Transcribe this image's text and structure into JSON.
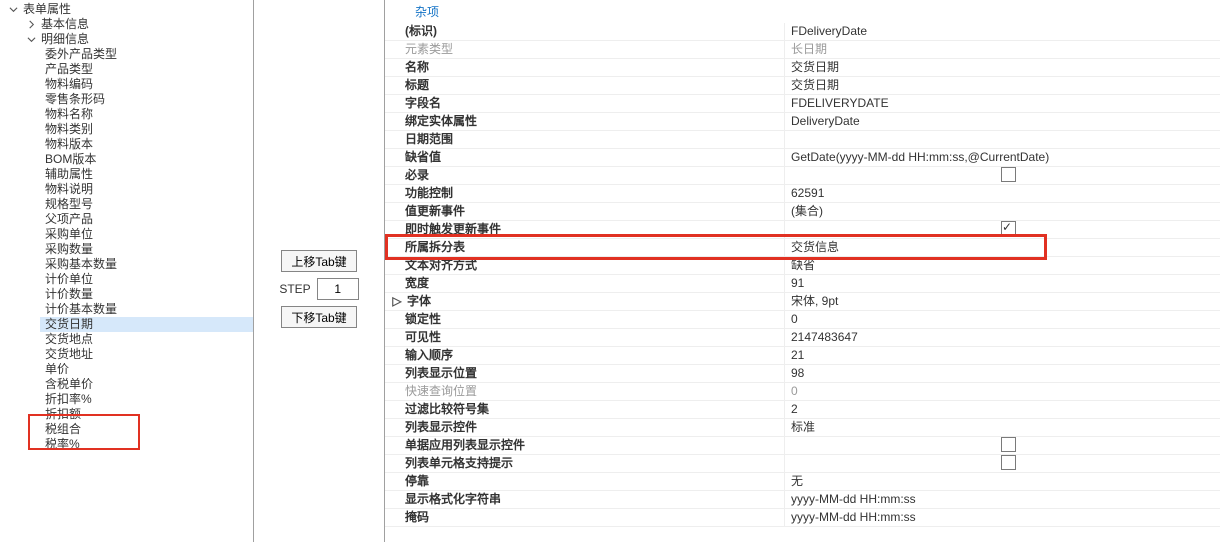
{
  "tree": {
    "root": {
      "label": "表单属性",
      "expanded": true
    },
    "basic": {
      "label": "基本信息",
      "expanded": false
    },
    "detail": {
      "label": "明细信息",
      "expanded": true
    },
    "items": [
      "委外产品类型",
      "产品类型",
      "物料编码",
      "零售条形码",
      "物料名称",
      "物料类别",
      "物料版本",
      "BOM版本",
      "辅助属性",
      "物料说明",
      "规格型号",
      "父项产品",
      "采购单位",
      "采购数量",
      "采购基本数量",
      "计价单位",
      "计价数量",
      "计价基本数量",
      "交货日期",
      "交货地点",
      "交货地址",
      "单价",
      "含税单价",
      "折扣率%",
      "折扣额",
      "税组合",
      "税率%"
    ],
    "selectedIndex": 18
  },
  "mid": {
    "btnUp": "上移Tab键",
    "stepLabel": "STEP",
    "stepValue": "1",
    "btnDown": "下移Tab键"
  },
  "cat": "杂项",
  "rows": [
    {
      "k": "(标识)",
      "v": "FDeliveryDate",
      "bold": true,
      "ind": 14
    },
    {
      "k": "元素类型",
      "v": "长日期",
      "dim": true,
      "ind": 14
    },
    {
      "k": "名称",
      "v": "交货日期",
      "bold": true,
      "ind": 14
    },
    {
      "k": "标题",
      "v": "交货日期",
      "bold": true,
      "ind": 14
    },
    {
      "k": "字段名",
      "v": "FDELIVERYDATE",
      "bold": true,
      "ind": 14
    },
    {
      "k": "绑定实体属性",
      "v": "DeliveryDate",
      "bold": true,
      "ind": 14
    },
    {
      "k": "日期范围",
      "v": "",
      "bold": true,
      "ind": 14
    },
    {
      "k": "缺省值",
      "v": "GetDate(yyyy-MM-dd HH:mm:ss,@CurrentDate)",
      "bold": true,
      "ind": 14
    },
    {
      "k": "必录",
      "v": "",
      "bold": true,
      "ind": 14,
      "chk": false
    },
    {
      "k": "功能控制",
      "v": "62591",
      "bold": true,
      "ind": 14
    },
    {
      "k": "值更新事件",
      "v": "(集合)",
      "bold": true,
      "ind": 14
    },
    {
      "k": "即时触发更新事件",
      "v": "",
      "bold": true,
      "ind": 14,
      "chk": true
    },
    {
      "k": "所属拆分表",
      "v": "交货信息",
      "bold": true,
      "ind": 14,
      "hl": true
    },
    {
      "k": "文本对齐方式",
      "v": "缺省",
      "bold": true,
      "ind": 14
    },
    {
      "k": "宽度",
      "v": "91",
      "bold": true,
      "ind": 14
    },
    {
      "k": "字体",
      "v": "宋体, 9pt",
      "bold": true,
      "ind": 14,
      "exp": "▹"
    },
    {
      "k": "锁定性",
      "v": "0",
      "bold": true,
      "ind": 14
    },
    {
      "k": "可见性",
      "v": "2147483647",
      "bold": true,
      "ind": 14
    },
    {
      "k": "输入顺序",
      "v": "21",
      "bold": true,
      "ind": 14
    },
    {
      "k": "列表显示位置",
      "v": "98",
      "bold": true,
      "ind": 14
    },
    {
      "k": "快速查询位置",
      "v": "0",
      "dim": true,
      "ind": 14
    },
    {
      "k": "过滤比较符号集",
      "v": "2",
      "bold": true,
      "ind": 14
    },
    {
      "k": "列表显示控件",
      "v": "标准",
      "bold": true,
      "ind": 14
    },
    {
      "k": "单据应用列表显示控件",
      "v": "",
      "bold": true,
      "ind": 14,
      "chk": false
    },
    {
      "k": "列表单元格支持提示",
      "v": "",
      "bold": true,
      "ind": 14,
      "chk": false
    },
    {
      "k": "停靠",
      "v": "无",
      "bold": true,
      "ind": 14
    },
    {
      "k": "显示格式化字符串",
      "v": "yyyy-MM-dd HH:mm:ss",
      "bold": true,
      "ind": 14
    },
    {
      "k": "掩码",
      "v": "yyyy-MM-dd HH:mm:ss",
      "bold": true,
      "ind": 14
    }
  ]
}
